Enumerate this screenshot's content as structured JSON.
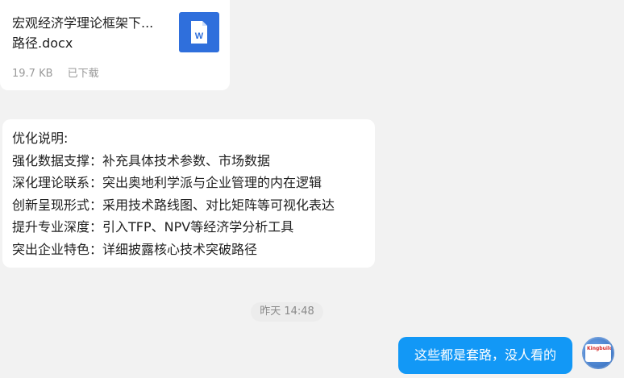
{
  "file_message": {
    "name_line1": "宏观经济学理论框架下...",
    "name_line2": "路径.docx",
    "size": "19.7 KB",
    "status": "已下载",
    "icon": "word-doc-icon",
    "icon_letter": "W"
  },
  "text_message": {
    "lines": [
      "优化说明:",
      "强化数据支撑：补充具体技术参数、市场数据",
      "深化理论联系：突出奥地利学派与企业管理的内在逻辑",
      "创新呈现形式：采用技术路线图、对比矩阵等可视化表达",
      "提升专业深度：引入TFP、NPV等经济学分析工具",
      "突出企业特色：详细披露核心技术突破路径"
    ]
  },
  "timestamp": "昨天 14:48",
  "my_message": {
    "text": "这些都是套路，没人看的"
  },
  "avatar": {
    "brand": "Kingbuilder",
    "icon": "user-avatar"
  },
  "colors": {
    "background": "#f2f2f2",
    "my_bubble": "#1298f6",
    "file_icon": "#2f6fdc"
  }
}
